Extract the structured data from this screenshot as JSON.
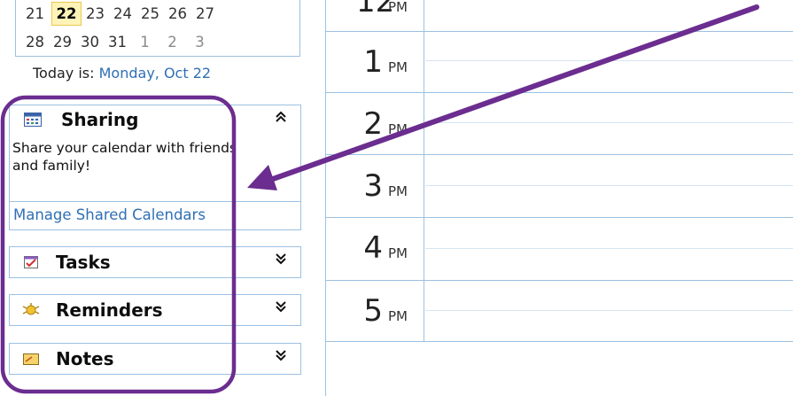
{
  "mini_calendar": {
    "week_rows": [
      [
        {
          "day": "21",
          "kind": "current"
        },
        {
          "day": "22",
          "kind": "today"
        },
        {
          "day": "23",
          "kind": "current"
        },
        {
          "day": "24",
          "kind": "current"
        },
        {
          "day": "25",
          "kind": "current"
        },
        {
          "day": "26",
          "kind": "current"
        },
        {
          "day": "27",
          "kind": "current"
        }
      ],
      [
        {
          "day": "28",
          "kind": "current"
        },
        {
          "day": "29",
          "kind": "current"
        },
        {
          "day": "30",
          "kind": "current"
        },
        {
          "day": "31",
          "kind": "current"
        },
        {
          "day": "1",
          "kind": "other"
        },
        {
          "day": "2",
          "kind": "other"
        },
        {
          "day": "3",
          "kind": "other"
        }
      ]
    ],
    "today_prefix": "Today is:",
    "today_link": "Monday, Oct 22"
  },
  "panels": {
    "sharing": {
      "title": "Sharing",
      "icon": "sharing-icon",
      "state": "expanded",
      "description": "Share your calendar with friends and family!",
      "link": "Manage Shared Calendars"
    },
    "tasks": {
      "title": "Tasks",
      "icon": "tasks-icon",
      "state": "collapsed"
    },
    "reminders": {
      "title": "Reminders",
      "icon": "reminders-icon",
      "state": "collapsed"
    },
    "notes": {
      "title": "Notes",
      "icon": "notes-icon",
      "state": "collapsed"
    }
  },
  "day_view": {
    "hours": [
      {
        "num": "12",
        "suffix": "PM"
      },
      {
        "num": "1",
        "suffix": "PM"
      },
      {
        "num": "2",
        "suffix": "PM"
      },
      {
        "num": "3",
        "suffix": "PM"
      },
      {
        "num": "4",
        "suffix": "PM"
      },
      {
        "num": "5",
        "suffix": "PM"
      }
    ]
  },
  "colors": {
    "border": "#9cc1e1",
    "link": "#2f6fb5",
    "today_highlight": "#fff3b8",
    "annotation": "#6b2d8f"
  }
}
